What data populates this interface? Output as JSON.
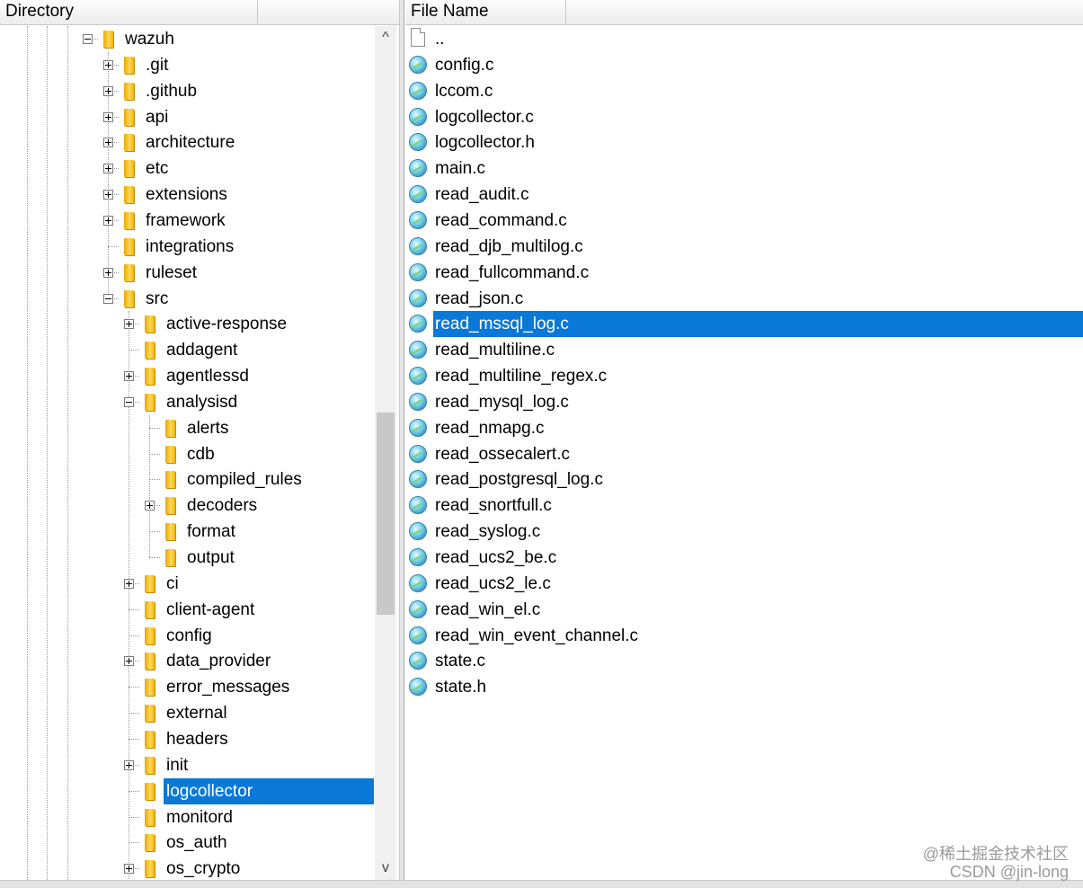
{
  "headers": {
    "directory": "Directory",
    "file_name": "File Name"
  },
  "tree": [
    {
      "label": "wazuh",
      "depth": 0,
      "expander": "minus"
    },
    {
      "label": ".git",
      "depth": 1,
      "expander": "plus"
    },
    {
      "label": ".github",
      "depth": 1,
      "expander": "plus"
    },
    {
      "label": "api",
      "depth": 1,
      "expander": "plus"
    },
    {
      "label": "architecture",
      "depth": 1,
      "expander": "plus"
    },
    {
      "label": "etc",
      "depth": 1,
      "expander": "plus"
    },
    {
      "label": "extensions",
      "depth": 1,
      "expander": "plus"
    },
    {
      "label": "framework",
      "depth": 1,
      "expander": "plus"
    },
    {
      "label": "integrations",
      "depth": 1,
      "expander": "none"
    },
    {
      "label": "ruleset",
      "depth": 1,
      "expander": "plus"
    },
    {
      "label": "src",
      "depth": 1,
      "expander": "minus"
    },
    {
      "label": "active-response",
      "depth": 2,
      "expander": "plus"
    },
    {
      "label": "addagent",
      "depth": 2,
      "expander": "none"
    },
    {
      "label": "agentlessd",
      "depth": 2,
      "expander": "plus"
    },
    {
      "label": "analysisd",
      "depth": 2,
      "expander": "minus"
    },
    {
      "label": "alerts",
      "depth": 3,
      "expander": "none"
    },
    {
      "label": "cdb",
      "depth": 3,
      "expander": "none"
    },
    {
      "label": "compiled_rules",
      "depth": 3,
      "expander": "none"
    },
    {
      "label": "decoders",
      "depth": 3,
      "expander": "plus"
    },
    {
      "label": "format",
      "depth": 3,
      "expander": "none"
    },
    {
      "label": "output",
      "depth": 3,
      "expander": "none"
    },
    {
      "label": "ci",
      "depth": 2,
      "expander": "plus"
    },
    {
      "label": "client-agent",
      "depth": 2,
      "expander": "none"
    },
    {
      "label": "config",
      "depth": 2,
      "expander": "none"
    },
    {
      "label": "data_provider",
      "depth": 2,
      "expander": "plus"
    },
    {
      "label": "error_messages",
      "depth": 2,
      "expander": "none"
    },
    {
      "label": "external",
      "depth": 2,
      "expander": "none"
    },
    {
      "label": "headers",
      "depth": 2,
      "expander": "none"
    },
    {
      "label": "init",
      "depth": 2,
      "expander": "plus"
    },
    {
      "label": "logcollector",
      "depth": 2,
      "expander": "none",
      "selected": true
    },
    {
      "label": "monitord",
      "depth": 2,
      "expander": "none"
    },
    {
      "label": "os_auth",
      "depth": 2,
      "expander": "none"
    },
    {
      "label": "os_crypto",
      "depth": 2,
      "expander": "plus"
    }
  ],
  "files": [
    {
      "name": "..",
      "icon": "parent-dir-icon"
    },
    {
      "name": "config.c",
      "icon": "c-source-file-icon"
    },
    {
      "name": "lccom.c",
      "icon": "c-source-file-icon"
    },
    {
      "name": "logcollector.c",
      "icon": "c-source-file-icon"
    },
    {
      "name": "logcollector.h",
      "icon": "c-source-file-icon"
    },
    {
      "name": "main.c",
      "icon": "c-source-file-icon"
    },
    {
      "name": "read_audit.c",
      "icon": "c-source-file-icon"
    },
    {
      "name": "read_command.c",
      "icon": "c-source-file-icon"
    },
    {
      "name": "read_djb_multilog.c",
      "icon": "c-source-file-icon"
    },
    {
      "name": "read_fullcommand.c",
      "icon": "c-source-file-icon"
    },
    {
      "name": "read_json.c",
      "icon": "c-source-file-icon"
    },
    {
      "name": "read_mssql_log.c",
      "icon": "c-source-file-icon",
      "selected": true
    },
    {
      "name": "read_multiline.c",
      "icon": "c-source-file-icon"
    },
    {
      "name": "read_multiline_regex.c",
      "icon": "c-source-file-icon"
    },
    {
      "name": "read_mysql_log.c",
      "icon": "c-source-file-icon"
    },
    {
      "name": "read_nmapg.c",
      "icon": "c-source-file-icon"
    },
    {
      "name": "read_ossecalert.c",
      "icon": "c-source-file-icon"
    },
    {
      "name": "read_postgresql_log.c",
      "icon": "c-source-file-icon"
    },
    {
      "name": "read_snortfull.c",
      "icon": "c-source-file-icon"
    },
    {
      "name": "read_syslog.c",
      "icon": "c-source-file-icon"
    },
    {
      "name": "read_ucs2_be.c",
      "icon": "c-source-file-icon"
    },
    {
      "name": "read_ucs2_le.c",
      "icon": "c-source-file-icon"
    },
    {
      "name": "read_win_el.c",
      "icon": "c-source-file-icon"
    },
    {
      "name": "read_win_event_channel.c",
      "icon": "c-source-file-icon"
    },
    {
      "name": "state.c",
      "icon": "c-source-file-icon"
    },
    {
      "name": "state.h",
      "icon": "c-source-file-icon"
    }
  ],
  "scrollbar": {
    "up_arrow": "^",
    "down_arrow": "v",
    "position_fraction": 0.45,
    "visible_fraction": 0.25
  },
  "watermark": {
    "line1": "@稀土掘金技术社区",
    "line2": "CSDN @jin-long"
  },
  "colors": {
    "selection": "#0a78d7",
    "folder": "#f2b400",
    "header_bg": "#f0f0f0"
  }
}
